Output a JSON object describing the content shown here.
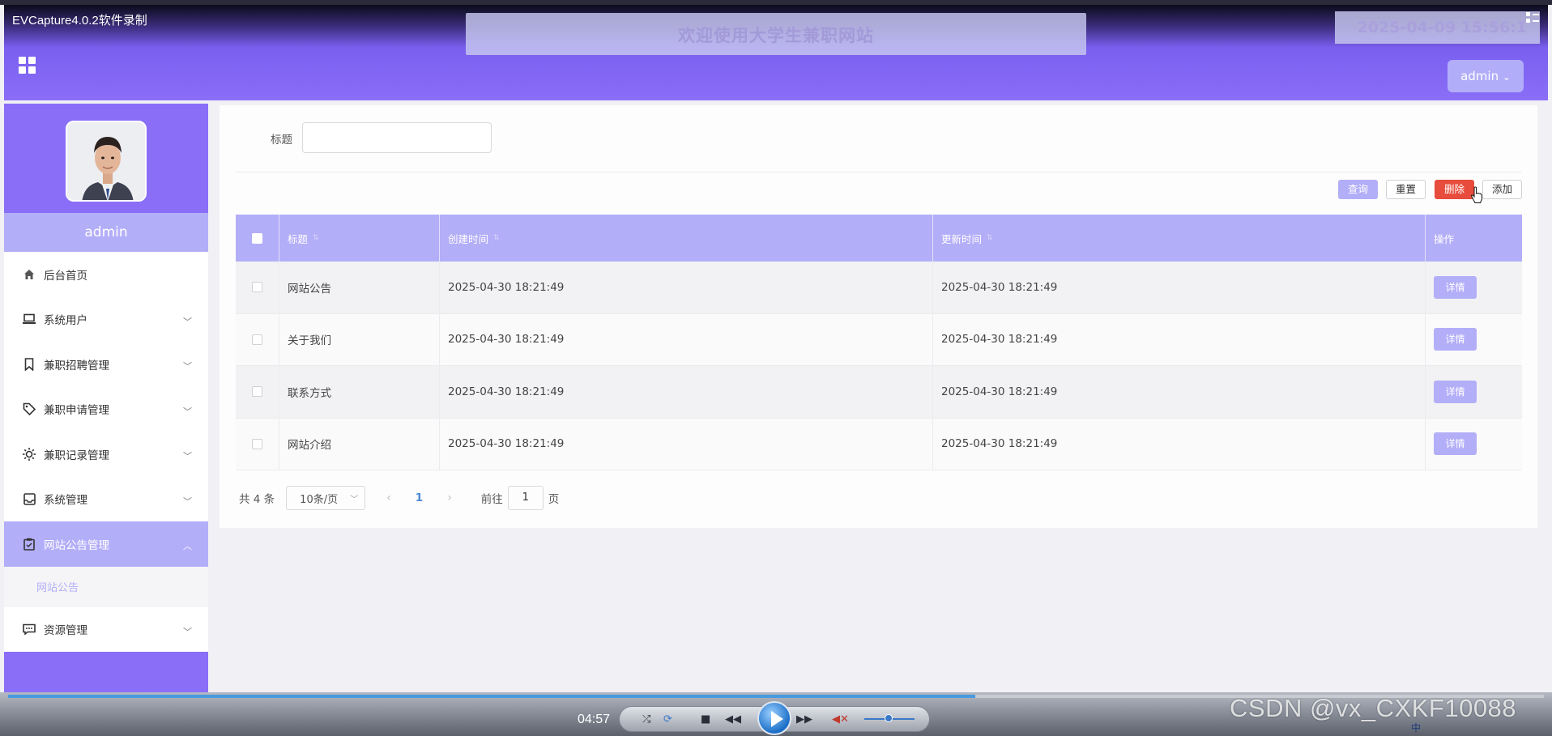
{
  "recorder": {
    "title": "EVCapture4.0.2软件录制"
  },
  "header": {
    "welcome": "欢迎使用大学生兼职网站",
    "datetime": "2025-04-09 15:56:1",
    "admin_button": "admin",
    "admin_caret": "⌄"
  },
  "sidebar": {
    "username": "admin",
    "items": [
      {
        "label": "后台首页",
        "icon": "home-icon",
        "has_chevron": false
      },
      {
        "label": "系统用户",
        "icon": "laptop-icon",
        "has_chevron": true
      },
      {
        "label": "兼职招聘管理",
        "icon": "bookmark-icon",
        "has_chevron": true
      },
      {
        "label": "兼职申请管理",
        "icon": "tag-icon",
        "has_chevron": true
      },
      {
        "label": "兼职记录管理",
        "icon": "sun-icon",
        "has_chevron": true
      },
      {
        "label": "系统管理",
        "icon": "inbox-icon",
        "has_chevron": true
      },
      {
        "label": "网站公告管理",
        "icon": "clipboard-icon",
        "has_chevron": true,
        "active": true
      },
      {
        "label": "资源管理",
        "icon": "chat-icon",
        "has_chevron": true
      }
    ],
    "submenu": {
      "label": "网站公告"
    }
  },
  "filter": {
    "label": "标题",
    "value": ""
  },
  "actions": {
    "query": "查询",
    "reset": "重置",
    "delete": "删除",
    "add": "添加"
  },
  "table": {
    "headers": {
      "title": "标题",
      "created": "创建时间",
      "updated": "更新时间",
      "ops": "操作"
    },
    "rows": [
      {
        "title": "网站公告",
        "created": "2025-04-30 18:21:49",
        "updated": "2025-04-30 18:21:49",
        "action": "详情"
      },
      {
        "title": "关于我们",
        "created": "2025-04-30 18:21:49",
        "updated": "2025-04-30 18:21:49",
        "action": "详情"
      },
      {
        "title": "联系方式",
        "created": "2025-04-30 18:21:49",
        "updated": "2025-04-30 18:21:49",
        "action": "详情"
      },
      {
        "title": "网站介绍",
        "created": "2025-04-30 18:21:49",
        "updated": "2025-04-30 18:21:49",
        "action": "详情"
      }
    ]
  },
  "pagination": {
    "total": "共 4 条",
    "page_size": "10条/页",
    "current": "1",
    "goto_prefix": "前往",
    "goto_value": "1",
    "goto_suffix": "页"
  },
  "player": {
    "time": "04:57",
    "progress": 0.63,
    "watermark": "CSDN @vx_CXKF10088",
    "tray": "中"
  },
  "colors": {
    "accent": "#8a6ef7",
    "accent_light": "#b3aef8",
    "danger": "#e74c3c",
    "link": "#4a8ad8"
  }
}
